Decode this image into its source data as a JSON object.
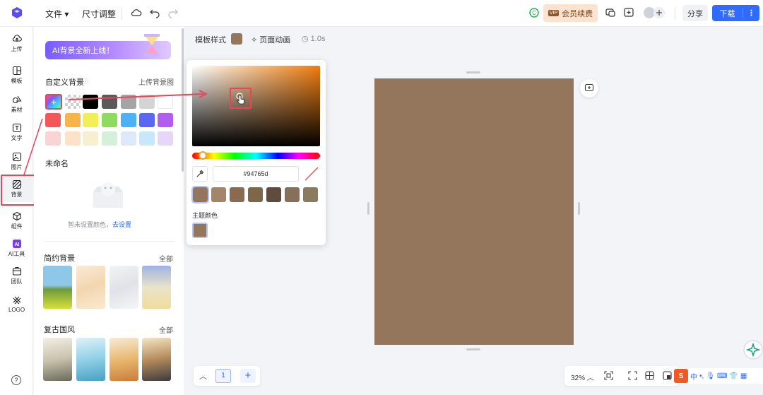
{
  "topbar": {
    "menu_file": "文件",
    "menu_resize": "尺寸调整",
    "vip_tag": "VIP",
    "vip_label": "会员续费",
    "share_label": "分享",
    "download_label": "下载",
    "download_more": "⋮",
    "brand_color": "#2f6bff"
  },
  "rail": {
    "items": [
      {
        "label": "上传",
        "icon": "upload-icon"
      },
      {
        "label": "模板",
        "icon": "template-icon"
      },
      {
        "label": "素材",
        "icon": "elements-icon"
      },
      {
        "label": "文字",
        "icon": "text-icon"
      },
      {
        "label": "图片",
        "icon": "image-icon"
      },
      {
        "label": "背景",
        "icon": "background-icon",
        "active": true
      },
      {
        "label": "组件",
        "icon": "components-icon"
      },
      {
        "label": "AI工具",
        "icon": "ai-icon"
      },
      {
        "label": "团队",
        "icon": "team-icon"
      },
      {
        "label": "LOGO",
        "icon": "logo-icon"
      }
    ],
    "help": "?"
  },
  "panel": {
    "banner_text": "AI背景全新上线！",
    "custom_bg_title": "自定义背景",
    "upload_bg_link": "上传背景图",
    "swatch_rows": [
      [
        "#000000",
        "#5a5a5a",
        "#a5a5a5",
        "#d4d4d4",
        "#ffffff"
      ],
      [
        "#f25858",
        "#f7b44a",
        "#f2ee55",
        "#8fdb5f",
        "#4fb1f5",
        "#5b67f2",
        "#b35df0"
      ],
      [
        "#fad3d3",
        "#fde3c6",
        "#f8efcf",
        "#d6efdb",
        "#dde9fb",
        "#c9e7fb",
        "#e6d7f8"
      ]
    ],
    "unnamed_title": "未命名",
    "empty_text": "暂未设置颜色，",
    "empty_link": "去设置",
    "simple_bg_title": "简约背景",
    "simple_bg_all": "全部",
    "retro_bg_title": "复古国风",
    "retro_bg_all": "全部"
  },
  "canvas": {
    "template_style_label": "模板样式",
    "page_anim_label": "页面动画",
    "duration": "1.0s",
    "page_color": "#94765d"
  },
  "picker": {
    "hex_value": "#94765d",
    "preset_colors": [
      "#94765d",
      "#a48569",
      "#8a6b4f",
      "#7e6648",
      "#5f4c3d",
      "#86705a",
      "#8a7a5e"
    ],
    "theme_label": "主题颜色",
    "theme_color": "#94765d"
  },
  "bottom": {
    "page_number": "1",
    "zoom": "32%",
    "ime_lang": "中"
  }
}
